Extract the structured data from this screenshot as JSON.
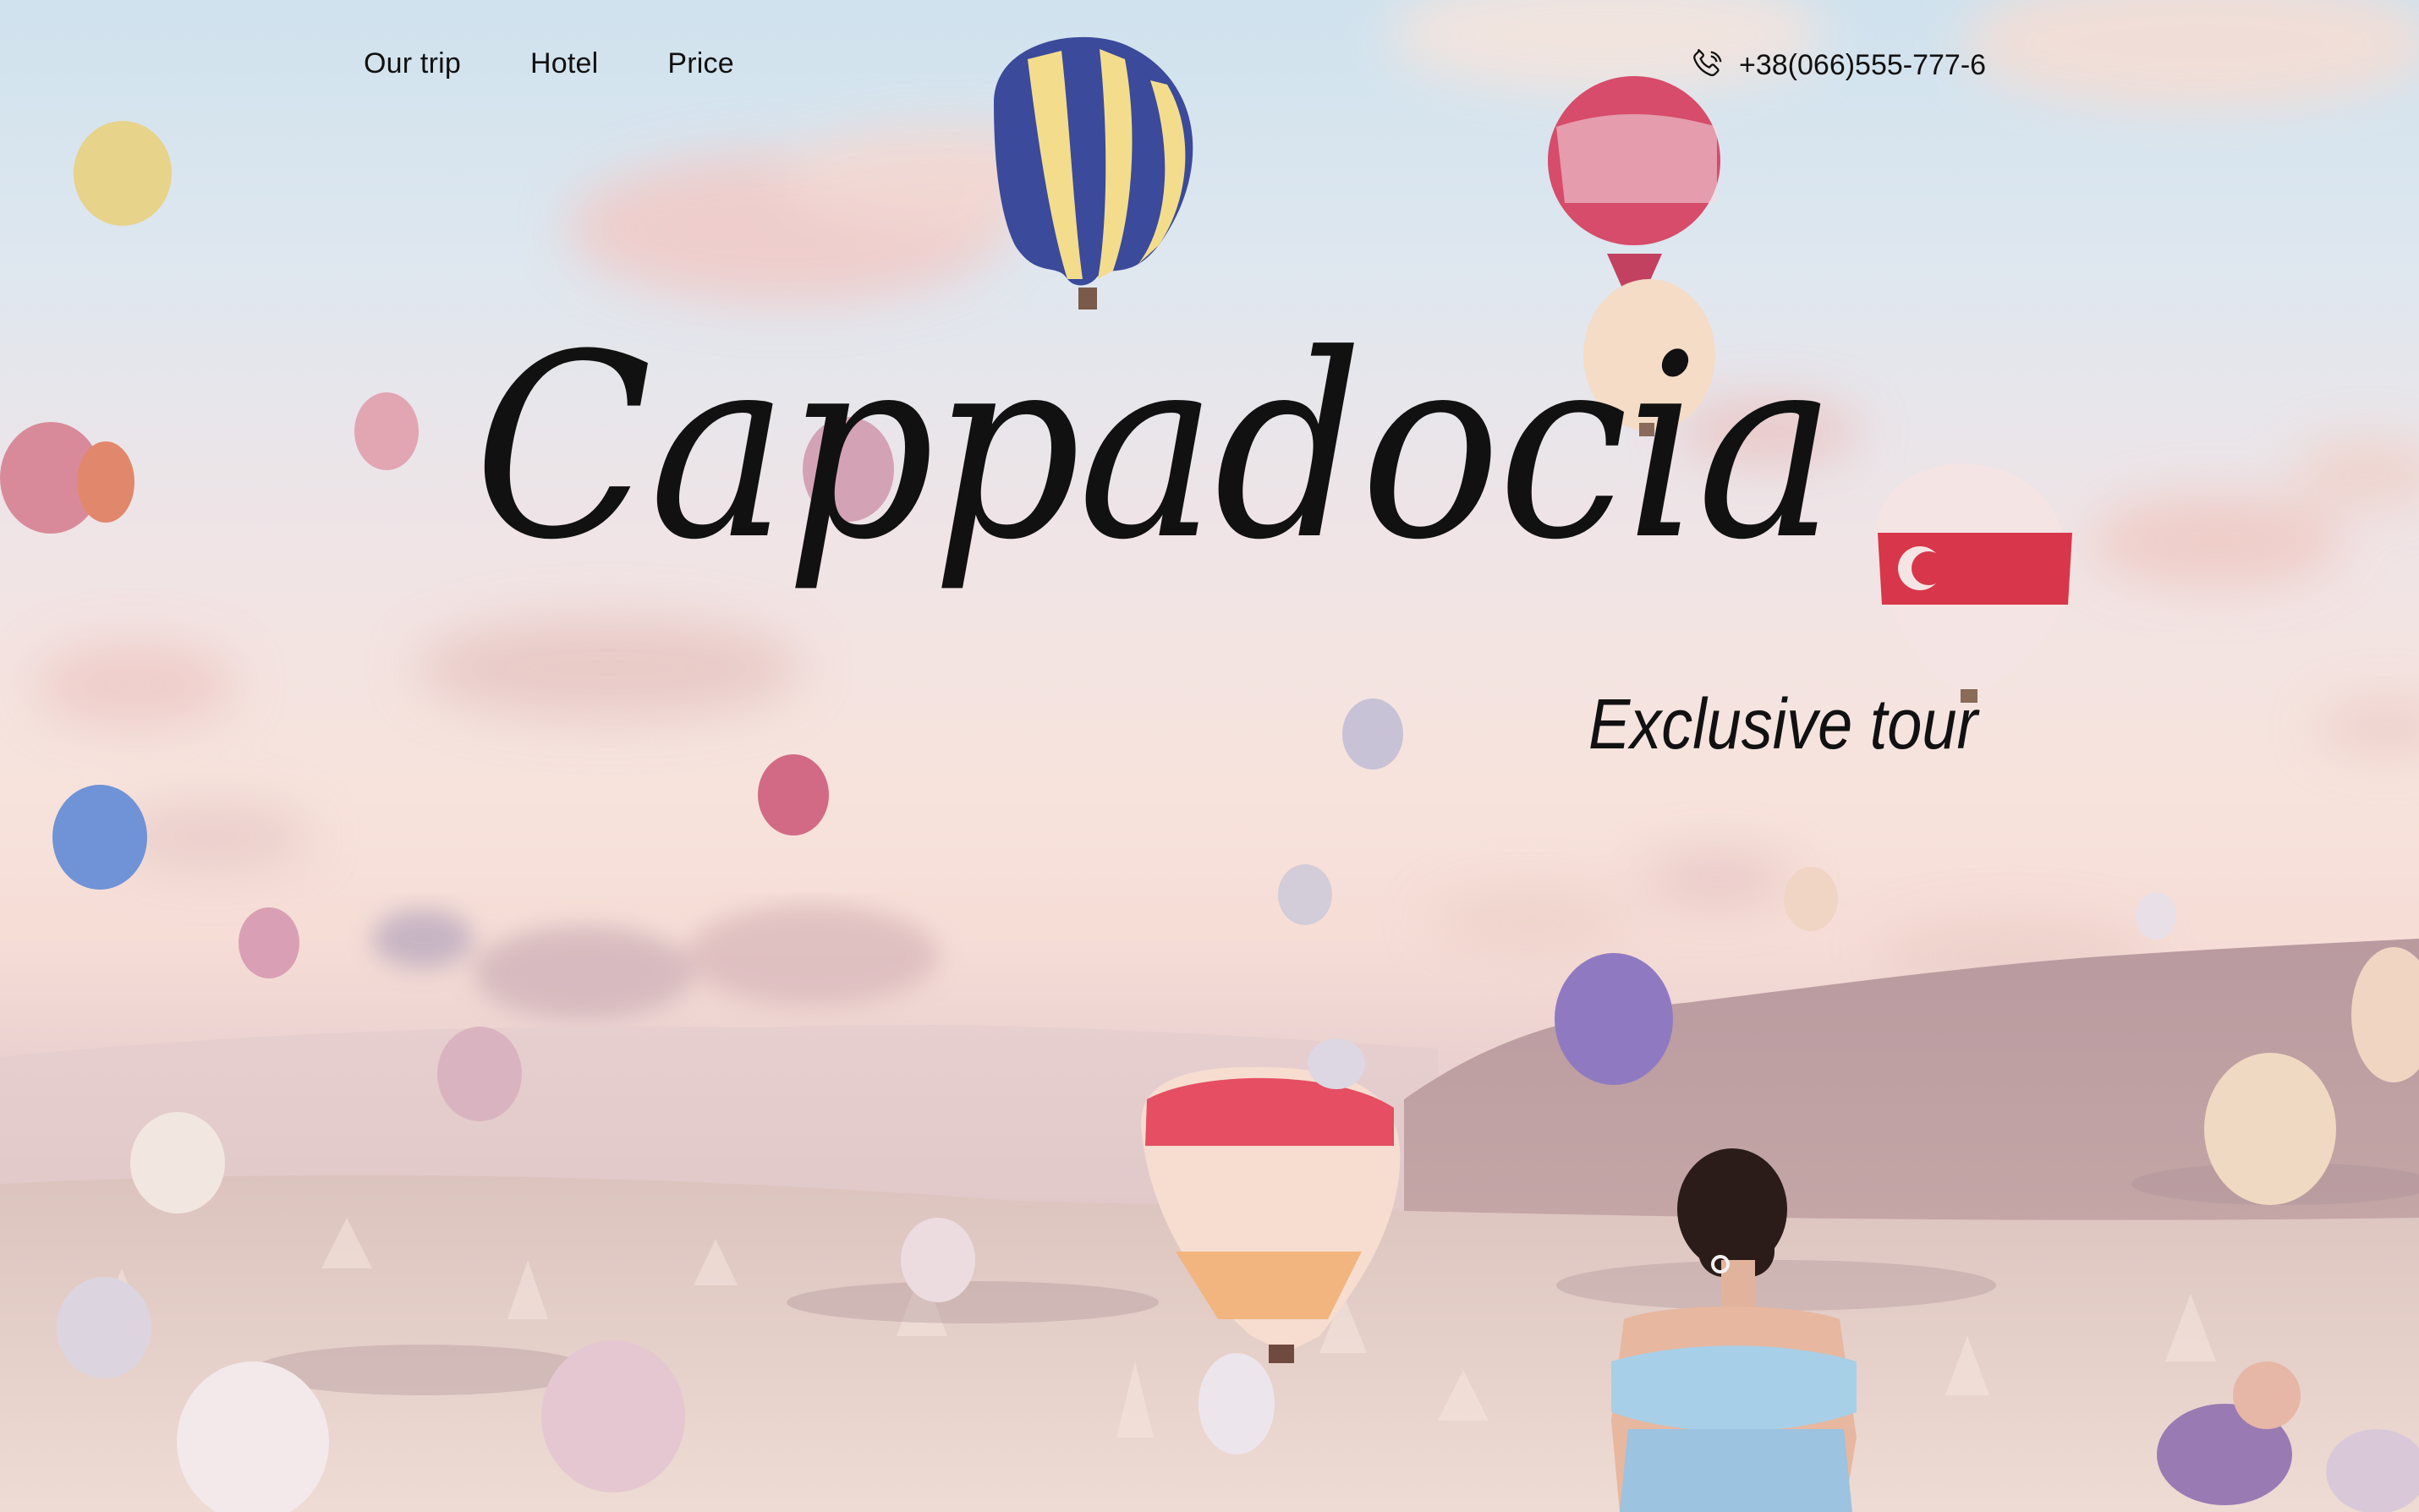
{
  "nav": {
    "items": [
      {
        "label": "Our trip"
      },
      {
        "label": "Hotel"
      },
      {
        "label": "Price"
      }
    ]
  },
  "contact": {
    "icon": "phone-icon",
    "phone": "+38(066)555-777-6"
  },
  "hero": {
    "title": "Cappadocia",
    "subtitle": "Exclusive tour"
  },
  "colors": {
    "text": "#111111",
    "sky_top": "#cfe2ee",
    "sky_horizon": "#f7e3dc",
    "terrain": "#ddc3c4"
  }
}
